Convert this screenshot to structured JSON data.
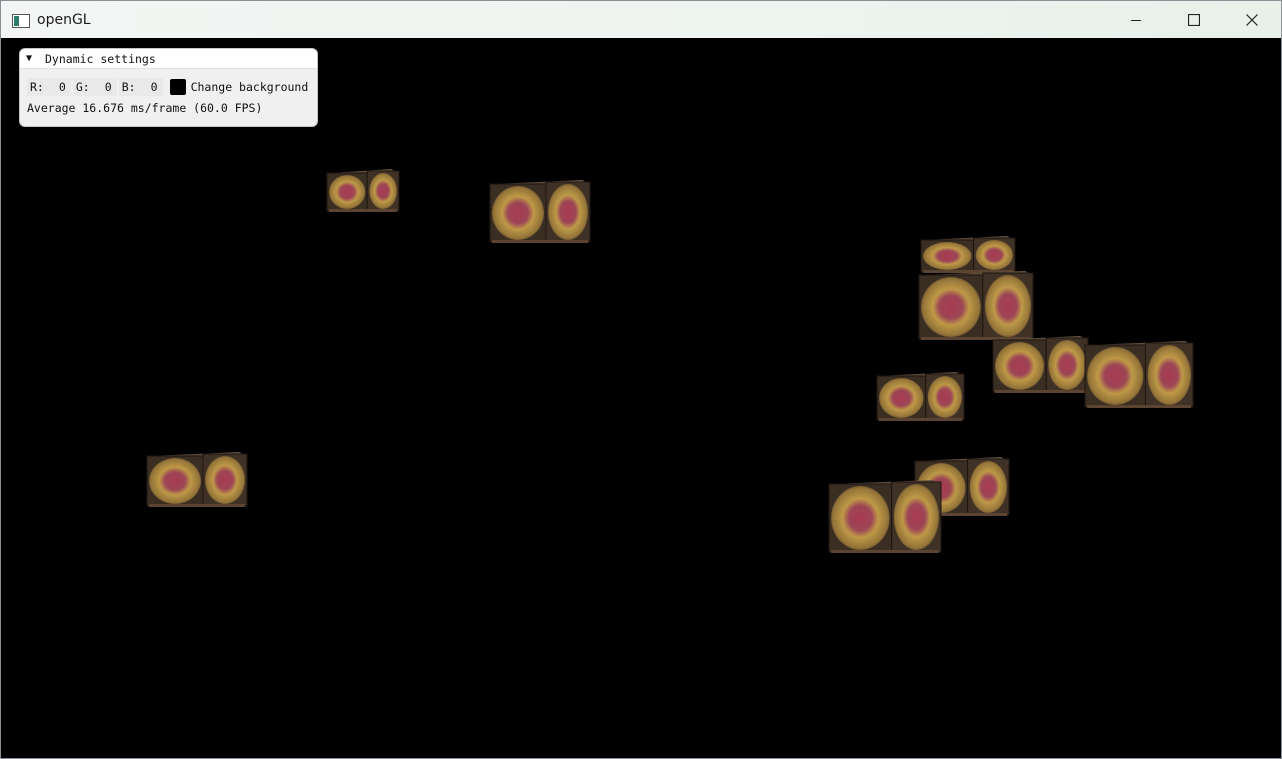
{
  "window": {
    "title": "openGL",
    "controls": {
      "minimize": "minimize",
      "maximize": "maximize",
      "close": "close"
    }
  },
  "settings_panel": {
    "header": "Dynamic settings",
    "channels": [
      {
        "label": "R:",
        "value": "0"
      },
      {
        "label": "G:",
        "value": "0"
      },
      {
        "label": "B:",
        "value": "0"
      }
    ],
    "swatch_color": "#000000",
    "change_background_label": "Change background",
    "stats": "Average 16.676 ms/frame (60.0 FPS)"
  },
  "scene": {
    "background": "#000000",
    "object": "textured-crate-cube",
    "count": 11
  }
}
